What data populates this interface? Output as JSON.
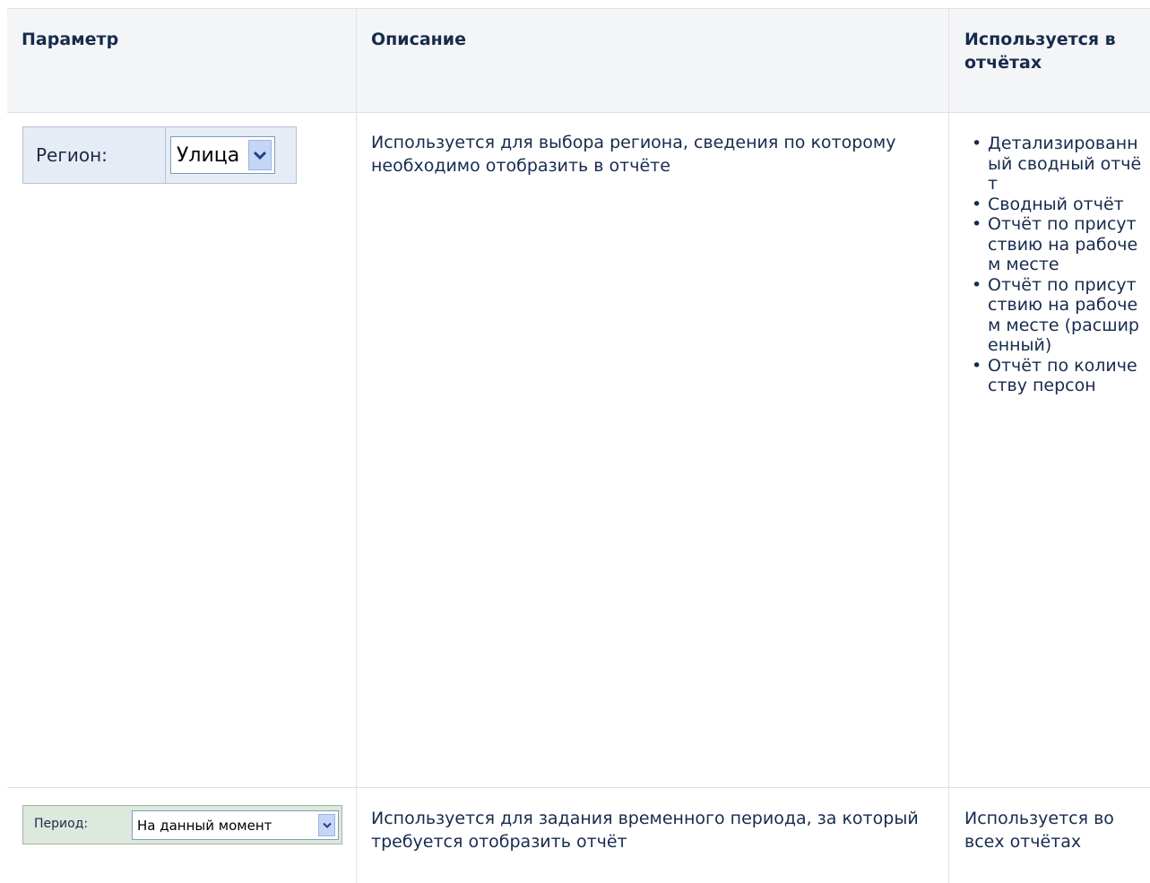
{
  "table": {
    "headers": [
      "Параметр",
      "Описание",
      "Используется в отчётах"
    ],
    "rows": [
      {
        "param_widget": {
          "label": "Регион:",
          "selected": "Улица"
        },
        "description": "Используется для выбора региона, сведения по которому необходимо отобразить в отчёте",
        "used_in": [
          "Детализированный сводный отчёт",
          "Сводный отчёт",
          "Отчёт по присутствию на рабочем месте",
          "Отчёт по присутствию на рабочем месте (расширенный)",
          "Отчёт по количеству персон"
        ]
      },
      {
        "param_widget": {
          "label": "Период:",
          "selected": "На данный момент"
        },
        "description": "Используется для задания временного периода, за который требуется отобразить отчёт",
        "used_in_text": "Используется во всех отчётах"
      }
    ]
  },
  "icons": {
    "dropdown_arrow": "chevron-down-icon"
  },
  "colors": {
    "header_bg": "#f4f5f7",
    "border": "#dfe1e6",
    "text": "#172b4d"
  }
}
